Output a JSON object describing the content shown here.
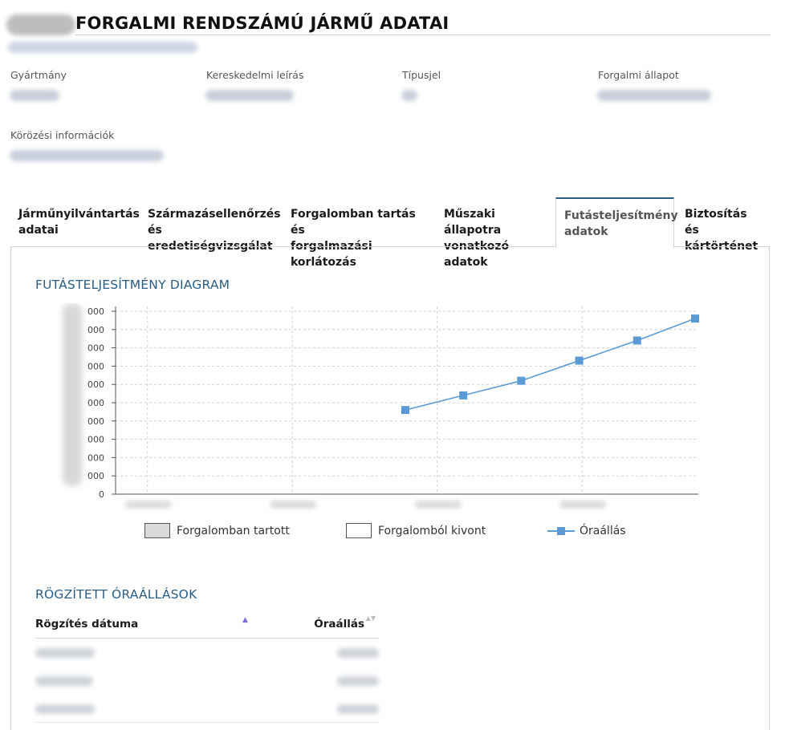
{
  "page": {
    "title": "FORGALMI RENDSZÁMÚ JÁRMŰ ADATAI"
  },
  "info": [
    {
      "label": "Gyártmány"
    },
    {
      "label": "Kereskedelmi leírás"
    },
    {
      "label": "Típusjel"
    },
    {
      "label": "Forgalmi állapot"
    },
    {
      "label": "Körözési információk"
    }
  ],
  "tabs": [
    {
      "line1": "Járműnyilvántartás",
      "line2": "adatai"
    },
    {
      "line1": "Származásellenőrzés",
      "line2": "és eredetiségvizsgálat"
    },
    {
      "line1": "Forgalomban tartás és",
      "line2": "forgalmazási korlátozás"
    },
    {
      "line1": "Műszaki állapotra",
      "line2": "vonatkozó adatok"
    },
    {
      "line1": "Futásteljesítmény",
      "line2": "adatok"
    },
    {
      "line1": "Biztosítás és",
      "line2": "kártörténet"
    }
  ],
  "chart_section_title": "FUTÁSTELJESÍTMÉNY DIAGRAM",
  "chart_data": {
    "type": "line",
    "y_tick_labels": [
      "0",
      "000",
      "000",
      "000",
      "000",
      "000",
      "000",
      "000",
      "000",
      "000",
      "000"
    ],
    "series": [
      {
        "name": "Óraállás",
        "color": "#5b9bd5",
        "points_index": [
          0,
          1,
          2,
          3,
          4,
          5
        ],
        "values": [
          4.6,
          5.4,
          6.2,
          7.3,
          8.4,
          9.6
        ]
      }
    ],
    "x_range": [
      0,
      1
    ],
    "x_positions": [
      0.5,
      0.6,
      0.7,
      0.8,
      0.9,
      1.0
    ],
    "ylim": [
      0,
      10
    ],
    "grid": true,
    "legend": [
      {
        "label": "Forgalomban tartott",
        "fill": "#d9d9d9"
      },
      {
        "label": "Forgalomból kivont",
        "fill": "#ffffff"
      },
      {
        "label": "Óraállás",
        "fill": "#5b9bd5"
      }
    ]
  },
  "table": {
    "title": "RÖGZÍTETT ÓRAÁLLÁSOK",
    "col_date": "Rögzítés dátuma",
    "col_value": "Óraállás",
    "sort_up": "▲",
    "sort_both": "▲▼"
  }
}
